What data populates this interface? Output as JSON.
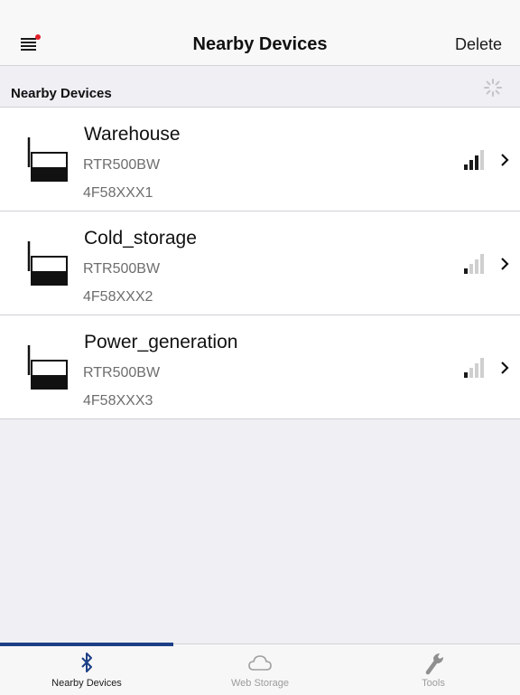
{
  "colors": {
    "accent": "#1d3f86",
    "notification_dot": "#e0202a",
    "signal_active": "#1a1a1a",
    "signal_inactive": "#cfcfcf",
    "secondary_text": "#6e6e6e"
  },
  "navbar": {
    "title": "Nearby Devices",
    "delete_label": "Delete",
    "menu_icon": "menu-icon"
  },
  "section": {
    "title": "Nearby Devices",
    "spinner_icon": "loading-spinner-icon"
  },
  "devices": [
    {
      "name": "Warehouse",
      "model": "RTR500BW",
      "serial": "4F58XXX1",
      "signal_bars": 3
    },
    {
      "name": "Cold_storage",
      "model": "RTR500BW",
      "serial": "4F58XXX2",
      "signal_bars": 1
    },
    {
      "name": "Power_generation",
      "model": "RTR500BW",
      "serial": "4F58XXX3",
      "signal_bars": 1
    }
  ],
  "tabs": [
    {
      "label": "Nearby Devices",
      "icon": "bluetooth-icon",
      "active": true
    },
    {
      "label": "Web Storage",
      "icon": "cloud-icon",
      "active": false
    },
    {
      "label": "Tools",
      "icon": "wrench-icon",
      "active": false
    }
  ]
}
